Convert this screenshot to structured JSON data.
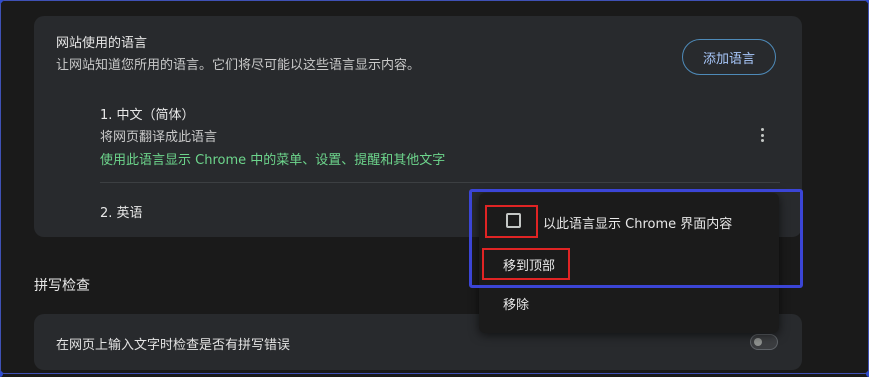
{
  "languages_section": {
    "title": "网站使用的语言",
    "subtitle": "让网站知道您所用的语言。它们将尽可能以这些语言显示内容。",
    "add_button": "添加语言",
    "items": [
      {
        "name": "1. 中文（简体）",
        "description": "将网页翻译成此语言",
        "note": "使用此语言显示 Chrome 中的菜单、设置、提醒和其他文字"
      },
      {
        "name": "2. 英语"
      }
    ]
  },
  "spellcheck_section": {
    "heading": "拼写检查",
    "option_label": "在网页上输入文字时检查是否有拼写错误",
    "toggle_on": false
  },
  "context_menu": {
    "items": [
      {
        "label": "以此语言显示 Chrome 界面内容",
        "checked": false
      },
      {
        "label": "移到顶部"
      },
      {
        "label": "移除"
      }
    ]
  },
  "colors": {
    "accent_blue": "#a8c7fa",
    "green_note": "#6dd58c",
    "highlight_blue": "#3b45d6",
    "highlight_red": "#e02424"
  }
}
